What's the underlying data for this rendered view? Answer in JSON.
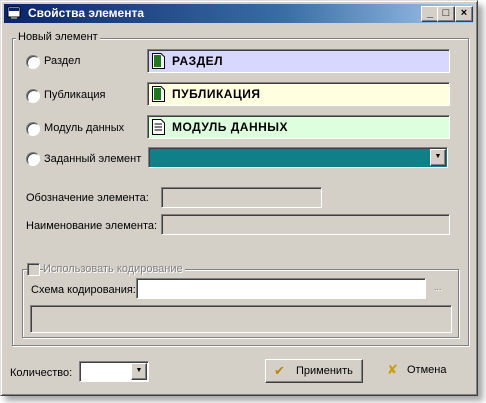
{
  "window": {
    "title": "Свойства элемента",
    "minimize": "_",
    "maximize": "□",
    "close": "×"
  },
  "group_new": {
    "legend": "Новый элемент",
    "options": [
      {
        "label": "Раздел",
        "value": "РАЗДЕЛ",
        "color": "#d8d8ff"
      },
      {
        "label": "Публикация",
        "value": "ПУБЛИКАЦИЯ",
        "color": "#ffffe0"
      },
      {
        "label": "Модуль данных",
        "value": "МОДУЛЬ ДАННЫХ",
        "color": "#ddffdd"
      }
    ],
    "custom_label": "Заданный элемент",
    "custom_color": "#0f7f88"
  },
  "fields": {
    "designation_label": "Обозначение элемента:",
    "name_label": "Наименование элемента:"
  },
  "coding": {
    "checkbox_label": "Использовать кодирование",
    "scheme_label": "Схема кодирования:",
    "scheme_button": "..."
  },
  "footer": {
    "quantity_label": "Количество:",
    "apply_label": "Применить",
    "cancel_label": "Отмена"
  }
}
